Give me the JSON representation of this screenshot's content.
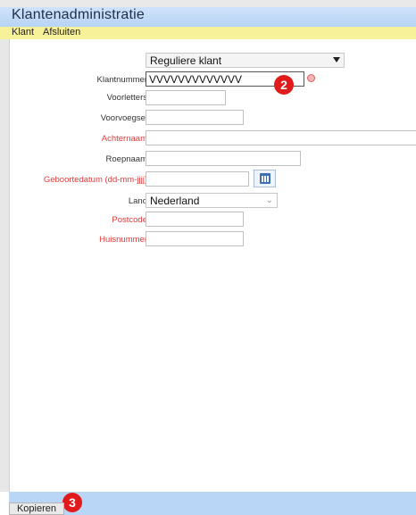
{
  "window": {
    "title": "Klantenadministratie"
  },
  "menu": {
    "items": [
      "Klant",
      "Afsluiten"
    ]
  },
  "form": {
    "klant_type": {
      "value": "Reguliere klant"
    },
    "klantnummer": {
      "label": "Klantnummer",
      "value": "VVVVVVVVVVVVV"
    },
    "voorletters": {
      "label": "Voorletters",
      "value": ""
    },
    "voorvoegsel": {
      "label": "Voorvoegsel",
      "value": ""
    },
    "achternaam": {
      "label": "Achternaam",
      "value": "",
      "required": true
    },
    "roepnaam": {
      "label": "Roepnaam",
      "value": ""
    },
    "geboortedatum": {
      "label": "Geboortedatum (dd-mm-jjjj)",
      "value": "",
      "required": true
    },
    "land": {
      "label": "Land",
      "value": "Nederland"
    },
    "postcode": {
      "label": "Postcode",
      "value": "",
      "required": true
    },
    "huisnummer": {
      "label": "Huisnummer",
      "value": "",
      "required": true
    }
  },
  "annotations": {
    "badge_2": "2",
    "badge_3": "3"
  },
  "footer": {
    "kopieren_label": "Kopieren"
  },
  "colors": {
    "required_label": "#e03b3b",
    "badge": "#e11b1b",
    "menubar": "#f7f19a",
    "titlebar": "#b7d3f4"
  },
  "icons": {
    "calendar": "calendar-icon",
    "dropdown": "chevron-down-icon",
    "warning": "warning-icon"
  }
}
